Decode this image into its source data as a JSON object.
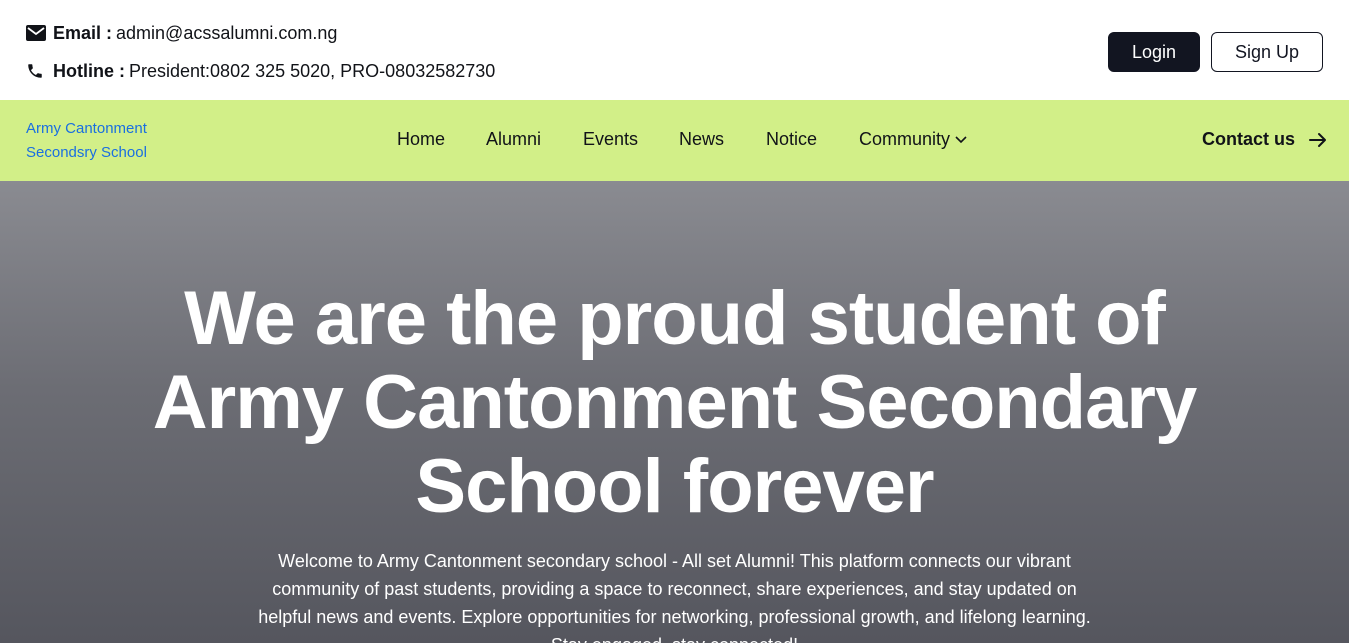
{
  "topbar": {
    "email_label": "Email :",
    "email_value": "admin@acssalumni.com.ng",
    "hotline_label": "Hotline :",
    "hotline_value": "President:0802 325 5020, PRO-08032582730",
    "icons": {
      "email": "envelope-icon",
      "hotline": "phone-icon"
    },
    "login_label": "Login",
    "signup_label": "Sign Up"
  },
  "nav": {
    "brand_line1": "Army Cantonment",
    "brand_line2": "Secondsry School",
    "items": [
      {
        "label": "Home"
      },
      {
        "label": "Alumni"
      },
      {
        "label": "Events"
      },
      {
        "label": "News"
      },
      {
        "label": "Notice"
      },
      {
        "label": "Community"
      }
    ],
    "contact_label": "Contact us",
    "icons": {
      "dropdown": "chevron-down-icon",
      "contact": "arrow-right-icon"
    }
  },
  "hero": {
    "title_lines": [
      "We are the proud student of",
      "Army Cantonment Secondary",
      "School forever"
    ],
    "text_lines": [
      "Welcome to Army Cantonment secondary school - All set Alumni! This platform connects our vibrant",
      "community of past students, providing a space to reconnect, share experiences, and stay updated on",
      "helpful news and events. Explore opportunities for networking, professional growth, and lifelong learning.",
      "Stay engaged, stay connected!"
    ]
  },
  "colors": {
    "nav_background": "#d2ef88",
    "brand_text": "#1a6fe0",
    "login_button": "#121521"
  }
}
